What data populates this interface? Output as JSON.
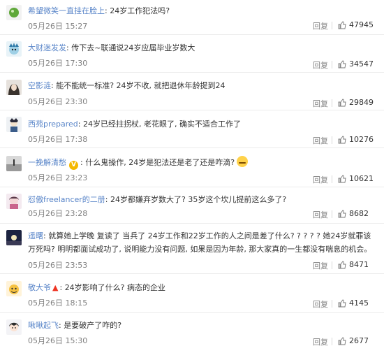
{
  "comments": [
    {
      "username": "希望微笑一直挂在脸上",
      "text": "24岁工作犯法吗?",
      "time": "05月26日 15:27",
      "reply_label": "回复",
      "likes": "47945"
    },
    {
      "username": "大财迷发发",
      "text": "传下去~联通说24岁应届毕业岁数大",
      "time": "05月26日 17:30",
      "reply_label": "回复",
      "likes": "34547"
    },
    {
      "username": "空影涟",
      "text": "能不能统一标准? 24岁不收, 就把退休年龄提到24",
      "time": "05月26日 23:30",
      "reply_label": "回复",
      "likes": "29849"
    },
    {
      "username": "西苑prepared",
      "text": "24岁已经拄拐杖, 老花眼了, 确实不适合工作了",
      "time": "05月26日 17:38",
      "reply_label": "回复",
      "likes": "10276"
    },
    {
      "username": "一挽解清愁",
      "text": "什么鬼操作, 24岁是犯法还是老了还是咋滴?",
      "time": "05月26日 23:23",
      "reply_label": "回复",
      "likes": "10621"
    },
    {
      "username": "怼傲freelancer的二册",
      "text": "24岁都嫌弃岁数大了? 35岁这个坎儿提前这么多了?",
      "time": "05月26日 23:28",
      "reply_label": "回复",
      "likes": "8682"
    },
    {
      "username": "遥曙",
      "text": "就算她上学晚 复读了 当兵了 24岁工作和22岁工作的人之间是差了什么? ? ? ? ? 她24岁就罪该万死吗? 明明都面试成功了, 说明能力没有问题, 如果是因为年龄, 那大家真的一生都没有喘息的机会。",
      "time": "05月26日 23:53",
      "reply_label": "回复",
      "likes": "8471"
    },
    {
      "username": "敬大爷",
      "text": "24岁影响了什么? 病态的企业",
      "time": "05月26日 18:15",
      "reply_label": "回复",
      "likes": "4145"
    },
    {
      "username": "啾啾起飞",
      "text": "是要破产了咋的?",
      "time": "05月26日 15:30",
      "reply_label": "回复",
      "likes": "2677"
    }
  ],
  "separator": ":",
  "icons": {
    "like": "thumbs-up-icon",
    "verified_badge": "v-badge-icon",
    "flame": "flame-icon",
    "emoji": "grinning-emoji-icon"
  },
  "colors": {
    "username": "#5a86c9",
    "meta": "#808080",
    "text": "#333333"
  }
}
